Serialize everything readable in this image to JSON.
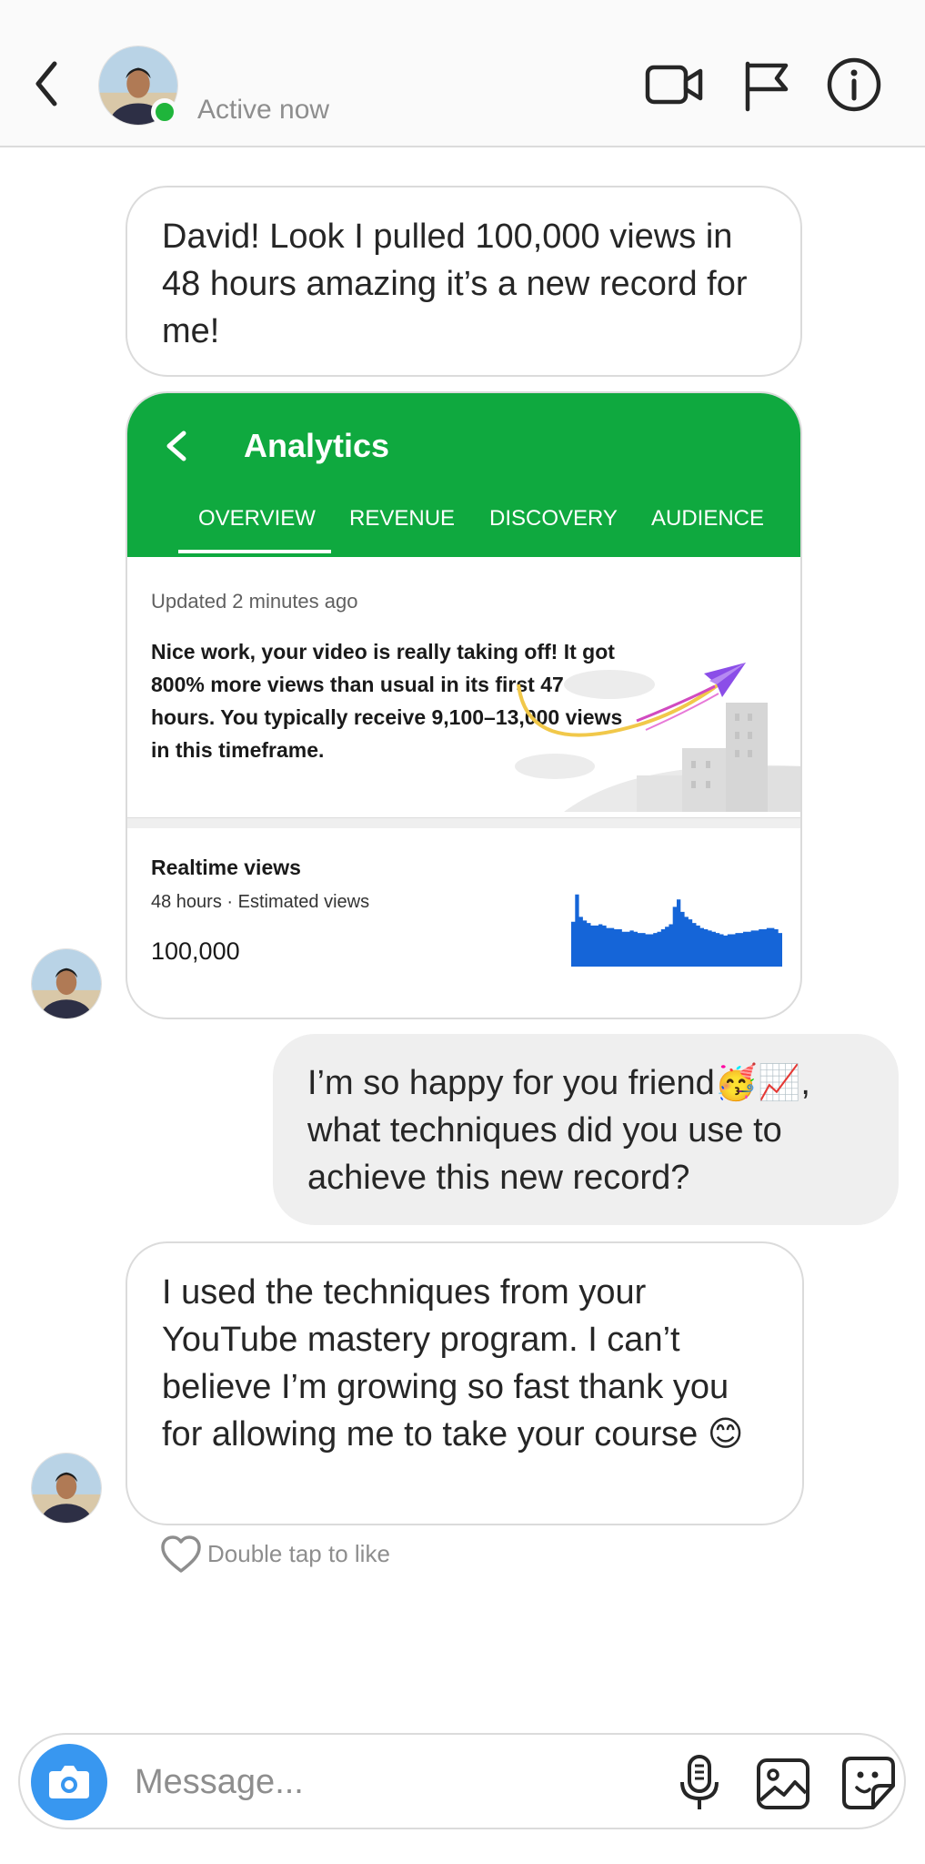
{
  "header": {
    "status": "Active now",
    "icons": [
      "back-chevron-icon",
      "video-call-icon",
      "flag-icon",
      "info-icon"
    ],
    "online_color": "#1fb53b"
  },
  "messages": {
    "m1": "David! Look I pulled 100,000 views in 48 hours amazing it’s a new record for me!",
    "m2_line1": "I’m so happy for you friend🥳📈,",
    "m2_line2": "what techniques did you use to",
    "m2_line3": "achieve this new record?",
    "m3": "I used the techniques from your YouTube mastery program. I can’t believe I’m growing so fast thank you for allowing me to take your course 😊"
  },
  "analytics_card": {
    "title": "Analytics",
    "tabs": [
      "OVERVIEW",
      "REVENUE",
      "DISCOVERY",
      "AUDIENCE"
    ],
    "active_tab": "OVERVIEW",
    "updated": "Updated 2 minutes ago",
    "body": "Nice work, your video is really taking off! It got 800% more views than usual in its first 47 hours. You typically receive 9,100–13,000 views in this timeframe.",
    "realtime_title": "Realtime views",
    "realtime_sub": "48 hours · Estimated views",
    "realtime_value": "100,000",
    "accent": "#0fa93f",
    "chart_color": "#1565d8",
    "sparkline": [
      36,
      58,
      40,
      37,
      35,
      33,
      33,
      34,
      33,
      31,
      31,
      30,
      30,
      28,
      28,
      29,
      28,
      27,
      27,
      26,
      26,
      27,
      28,
      30,
      32,
      34,
      48,
      54,
      44,
      40,
      38,
      35,
      33,
      31,
      30,
      29,
      28,
      27,
      26,
      25,
      26,
      26,
      27,
      27,
      28,
      28,
      29,
      29,
      30,
      30,
      31,
      31,
      30,
      27
    ]
  },
  "like_hint": "Double tap to like",
  "composer": {
    "placeholder": "Message...",
    "icons": [
      "camera-icon",
      "microphone-icon",
      "gallery-icon",
      "sticker-icon"
    ],
    "camera_color": "#3897f0"
  }
}
